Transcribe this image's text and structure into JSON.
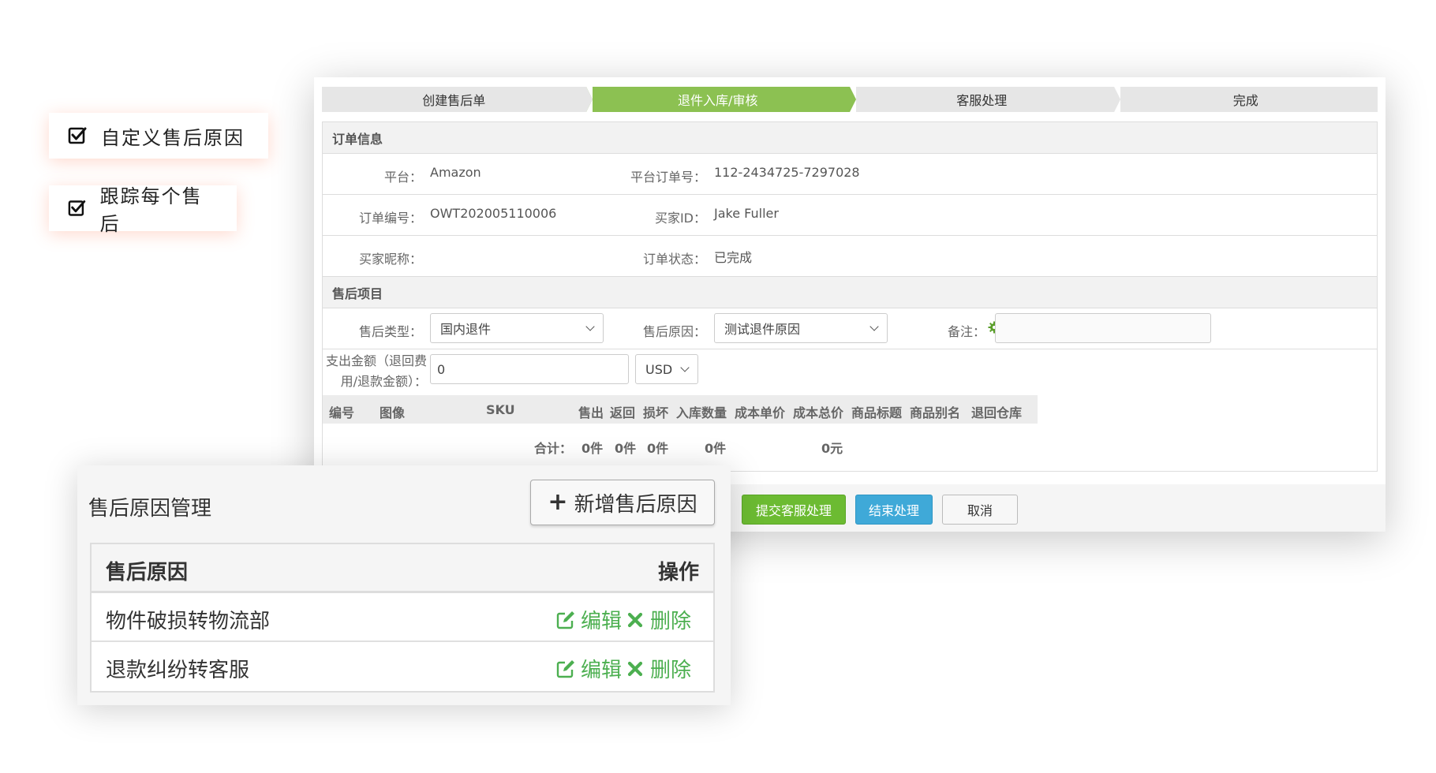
{
  "badges": [
    {
      "label": "自定义售后原因",
      "icon": "checkbox-checked-icon"
    },
    {
      "label": "跟踪每个售后",
      "icon": "checkbox-checked-icon"
    }
  ],
  "steps": [
    "创建售后单",
    "退件入库/审核",
    "客服处理",
    "完成"
  ],
  "active_step": 1,
  "order": {
    "section_title": "订单信息",
    "platform_label": "平台：",
    "platform_value": "Amazon",
    "platform_order_label": "平台订单号：",
    "platform_order_value": "112-2434725-7297028",
    "order_no_label": "订单编号：",
    "order_no_value": "OWT202005110006",
    "buyer_id_label": "买家ID：",
    "buyer_id_value": "Jake Fuller",
    "buyer_nick_label": "买家昵称：",
    "buyer_nick_value": "",
    "status_label": "订单状态：",
    "status_value": "已完成"
  },
  "aftersale": {
    "section_title": "售后项目",
    "type_label": "售后类型：",
    "type_value": "国内退件",
    "reason_label": "售后原因：",
    "reason_value": "测试退件原因",
    "note_label": "备注：",
    "note_value": "",
    "amount_label_1": "支出金额（退回费",
    "amount_label_2": "用/退款金额）：",
    "amount_value": "0",
    "currency_value": "USD"
  },
  "items_table": {
    "columns": [
      "编号",
      "图像",
      "SKU",
      "售出",
      "返回",
      "损坏",
      "入库数量",
      "成本单价",
      "成本总价",
      "商品标题",
      "商品别名",
      "退回仓库"
    ],
    "total_label": "合计：",
    "totals": [
      "0件",
      "0件",
      "0件",
      "0件",
      "0元"
    ]
  },
  "buttons": {
    "submit": "提交客服处理",
    "finish": "结束处理",
    "cancel": "取消"
  },
  "reason_manager": {
    "title": "售后原因管理",
    "add_label": "新增售后原因",
    "col_reason": "售后原因",
    "col_action": "操作",
    "edit_label": "编辑",
    "delete_label": "删除",
    "rows": [
      "物件破损转物流部",
      "退款纠纷转客服"
    ]
  },
  "colors": {
    "step_active": "#8cc152",
    "primary_green": "#6cbb32",
    "primary_blue": "#3fa9d8",
    "action_green": "#4caf50"
  }
}
